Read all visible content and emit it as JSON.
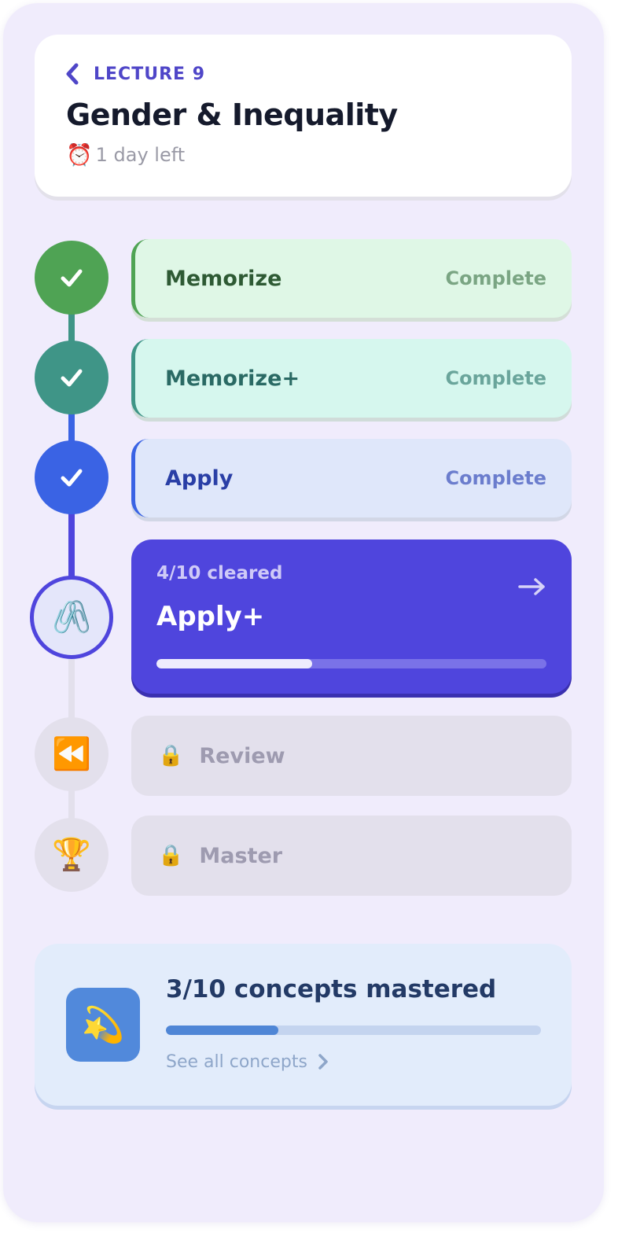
{
  "header": {
    "lecture_label": "LECTURE 9",
    "title": "Gender & Inequality",
    "deadline_emoji": "⏰",
    "deadline_text": "1 day left"
  },
  "steps": [
    {
      "name": "Memorize",
      "status": "Complete",
      "state": "complete",
      "accent": "#4fa354"
    },
    {
      "name": "Memorize+",
      "status": "Complete",
      "state": "complete",
      "accent": "#3f9587"
    },
    {
      "name": "Apply",
      "status": "Complete",
      "state": "complete",
      "accent": "#3a63e4"
    },
    {
      "name": "Apply+",
      "progress_text": "4/10 cleared",
      "cleared": 4,
      "total": 10,
      "state": "active",
      "node_emoji": "🖇️",
      "accent": "#4f45dd"
    },
    {
      "name": "Review",
      "state": "locked",
      "node_emoji": "⏪",
      "lock_emoji": "🔒"
    },
    {
      "name": "Master",
      "state": "locked",
      "node_emoji": "🏆",
      "lock_emoji": "🔒"
    }
  ],
  "concepts": {
    "icon_emoji": "💫",
    "title": "3/10 concepts mastered",
    "mastered": 3,
    "total": 10,
    "link_text": "See all concepts"
  }
}
